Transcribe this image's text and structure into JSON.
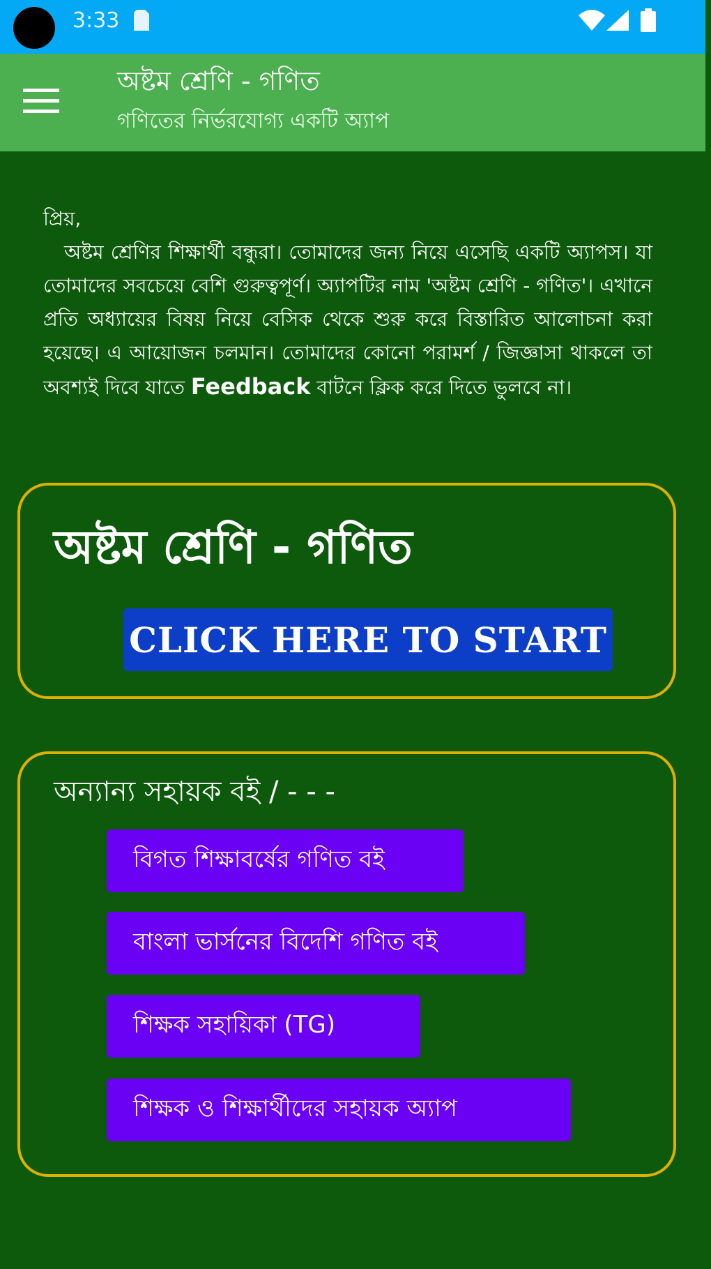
{
  "status_bar": {
    "time": "3:33",
    "icons": [
      "camera-cutout",
      "sim-card-icon",
      "wifi-icon",
      "signal-icon",
      "battery-icon"
    ]
  },
  "app_bar": {
    "title": "অষ্টম শ্রেণি - গণিত",
    "subtitle": "গণিতের নির্ভরযোগ্য একটি অ্যাপ",
    "menu_icon": "hamburger-menu-icon"
  },
  "intro": {
    "greeting": "প্রিয়,",
    "text_before": "অষ্টম শ্রেণির শিক্ষার্থী বন্ধুরা। তোমাদের জন্য নিয়ে এসেছি একটি অ্যাপস। যা তোমাদের সবচেয়ে বেশি গুরুত্বপূর্ণ। অ্যাপটির নাম 'অষ্টম শ্রেণি - গণিত'। এখানে প্রতি অধ্যায়ের বিষয় নিয়ে বেসিক থেকে শুরু করে বিস্তারিত আলোচনা করা হয়েছে। এ আয়োজন চলমান। তোমাদের কোনো পরামর্শ / জিজ্ঞাসা থাকলে তা অবশ্যই দিবে যাতে",
    "feedback_word": "Feedback",
    "text_after": "বাটনে ক্লিক করে দিতে ভুলবে না।"
  },
  "main_card": {
    "title": "অষ্টম শ্রেণি - গণিত",
    "start_button": "CLICK HERE TO START"
  },
  "books_card": {
    "heading": "অন্যান্য সহায়ক বই / - - -",
    "buttons": [
      {
        "label": "বিগত শিক্ষাবর্ষের গণিত বই"
      },
      {
        "label": "বাংলা ভার্সনের বিদেশি গণিত বই"
      },
      {
        "label": "শিক্ষক সহায়িকা (TG)"
      },
      {
        "label": "শিক্ষক ও শিক্ষার্থীদের সহায়ক অ্যাপ"
      }
    ]
  },
  "colors": {
    "status_bar": "#03a9f4",
    "app_bar": "#4caf50",
    "background": "#0e5a0c",
    "card_border": "#e0b000",
    "start_button": "#0d3ec8",
    "book_button": "#6a00f4"
  }
}
